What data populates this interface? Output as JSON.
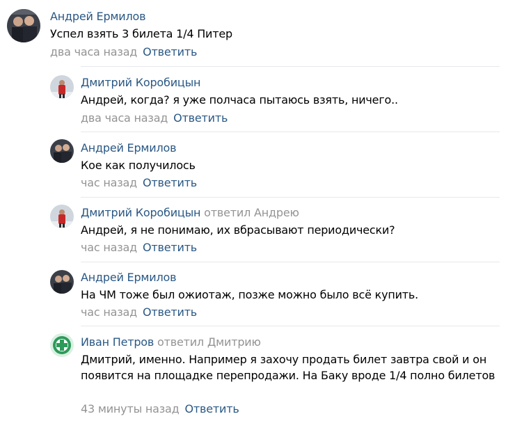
{
  "thread": {
    "reply_label": "Ответить",
    "comments": [
      {
        "author": "Андрей Ермилов",
        "text": "Успел взять 3 билета 1/4 Питер",
        "time": "два часа назад"
      },
      {
        "author": "Дмитрий Коробицын",
        "text": "Андрей, когда? я уже полчаса пытаюсь взять, ничего..",
        "time": "два часа назад"
      },
      {
        "author": "Андрей Ермилов",
        "text": "Кое как получилось",
        "time": "час назад"
      },
      {
        "author": "Дмитрий Коробицын",
        "replied": "ответил",
        "reply_to": "Андрею",
        "text": "Андрей, я не понимаю, их вбрасывают периодически?",
        "time": "час назад"
      },
      {
        "author": "Андрей Ермилов",
        "text": "На ЧМ тоже был ожиотаж, позже можно было всё купить.",
        "time": "час назад"
      },
      {
        "author": "Иван Петров",
        "replied": "ответил",
        "reply_to": "Дмитрию",
        "text": "Дмитрий, именно. Например я захочу продать билет завтра свой и он появится на площадке перепродажи. На Баку вроде 1/4 полно билетов",
        "time": "43 минуты назад"
      }
    ]
  },
  "colors": {
    "link": "#2a5885",
    "muted": "#939393",
    "divider": "#e7e8ec"
  }
}
